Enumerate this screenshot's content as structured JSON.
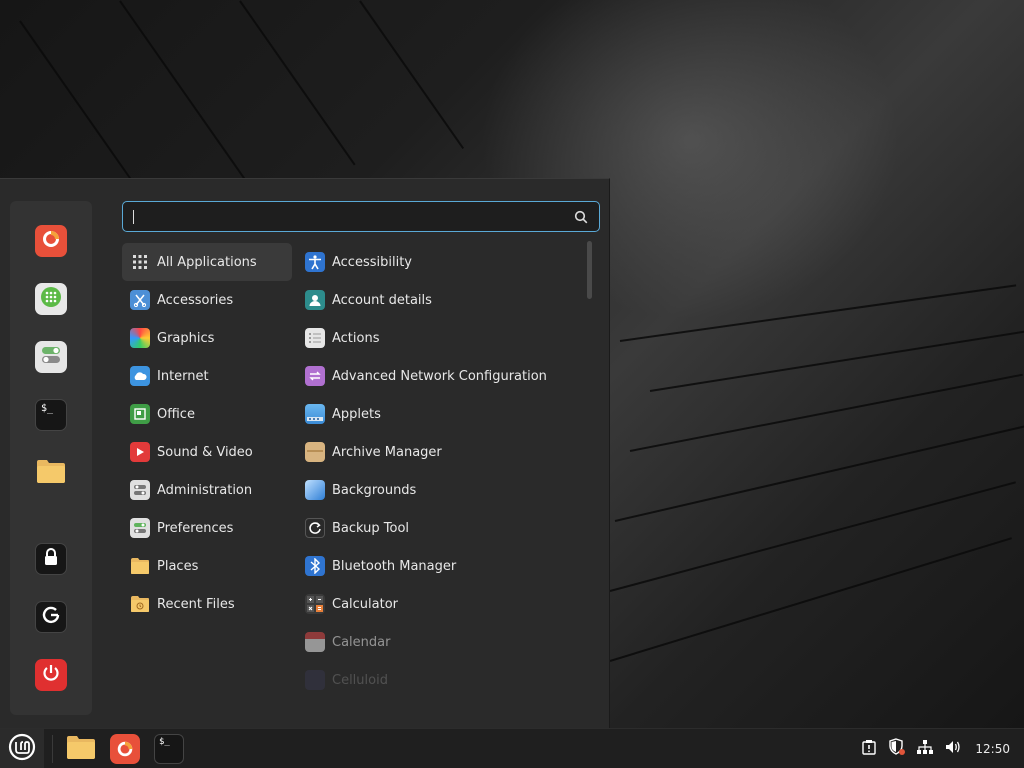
{
  "search": {
    "value": "",
    "placeholder": ""
  },
  "favorites": [
    {
      "name": "firefox",
      "icon": "firefox-icon"
    },
    {
      "name": "software-manager",
      "icon": "software-manager-icon"
    },
    {
      "name": "system-settings",
      "icon": "settings-toggle-icon"
    },
    {
      "name": "terminal",
      "icon": "terminal-icon"
    },
    {
      "name": "files",
      "icon": "folder-icon"
    },
    {
      "name": "lock-screen",
      "icon": "lock-icon"
    },
    {
      "name": "logout",
      "icon": "logout-icon"
    },
    {
      "name": "shutdown",
      "icon": "power-icon"
    }
  ],
  "categories": [
    {
      "label": "All Applications",
      "icon": "grid-icon",
      "selected": true
    },
    {
      "label": "Accessories",
      "icon": "accessories-icon"
    },
    {
      "label": "Graphics",
      "icon": "graphics-icon"
    },
    {
      "label": "Internet",
      "icon": "internet-icon"
    },
    {
      "label": "Office",
      "icon": "office-icon"
    },
    {
      "label": "Sound & Video",
      "icon": "sound-video-icon"
    },
    {
      "label": "Administration",
      "icon": "administration-icon"
    },
    {
      "label": "Preferences",
      "icon": "preferences-icon"
    },
    {
      "label": "Places",
      "icon": "places-icon"
    },
    {
      "label": "Recent Files",
      "icon": "recent-files-icon"
    }
  ],
  "apps": [
    {
      "label": "Accessibility",
      "icon": "accessibility-icon"
    },
    {
      "label": "Account details",
      "icon": "account-icon"
    },
    {
      "label": "Actions",
      "icon": "actions-icon"
    },
    {
      "label": "Advanced Network Configuration",
      "icon": "network-config-icon"
    },
    {
      "label": "Applets",
      "icon": "applets-icon"
    },
    {
      "label": "Archive Manager",
      "icon": "archive-icon"
    },
    {
      "label": "Backgrounds",
      "icon": "backgrounds-icon"
    },
    {
      "label": "Backup Tool",
      "icon": "backup-icon"
    },
    {
      "label": "Bluetooth Manager",
      "icon": "bluetooth-icon"
    },
    {
      "label": "Calculator",
      "icon": "calculator-icon"
    },
    {
      "label": "Calendar",
      "icon": "calendar-icon"
    },
    {
      "label": "Celluloid",
      "icon": "celluloid-icon"
    }
  ],
  "panel": {
    "launchers": [
      {
        "name": "files",
        "icon": "folder-icon"
      },
      {
        "name": "firefox",
        "icon": "firefox-icon"
      },
      {
        "name": "terminal",
        "icon": "terminal-icon"
      }
    ],
    "clock": "12:50",
    "terminal_glyph": "$_"
  },
  "colors": {
    "accent": "#5aa9d6",
    "menu_bg": "#2a2a2a",
    "favbar_bg": "#333333",
    "panel_bg": "#1f1f1f"
  }
}
